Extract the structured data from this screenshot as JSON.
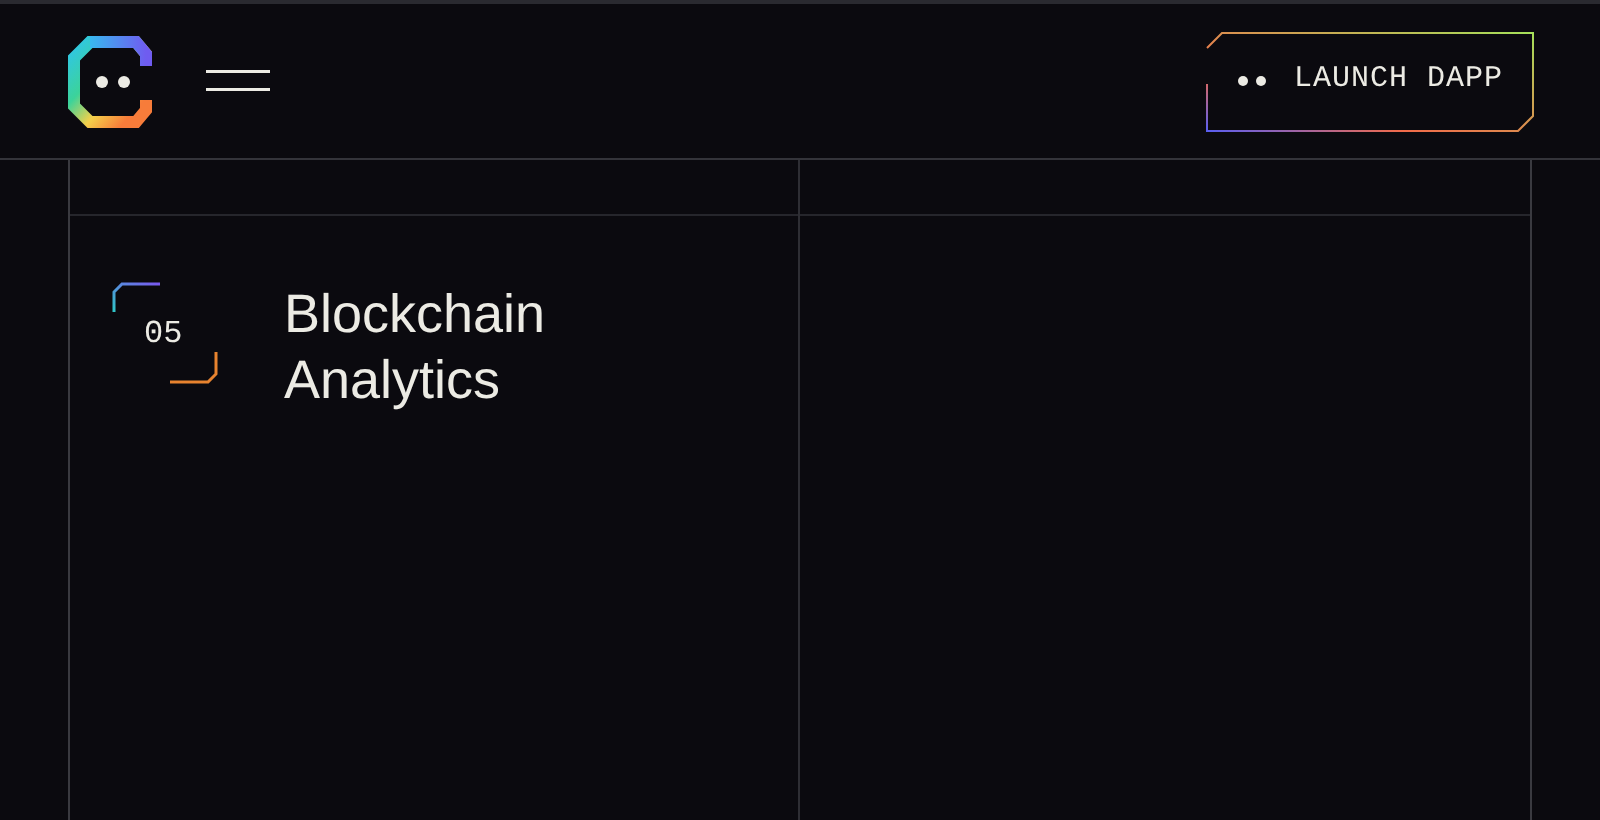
{
  "header": {
    "launch_button": {
      "label": "LAUNCH DAPP"
    }
  },
  "features": [
    {
      "number": "05",
      "title": "Blockchain Analytics"
    }
  ]
}
